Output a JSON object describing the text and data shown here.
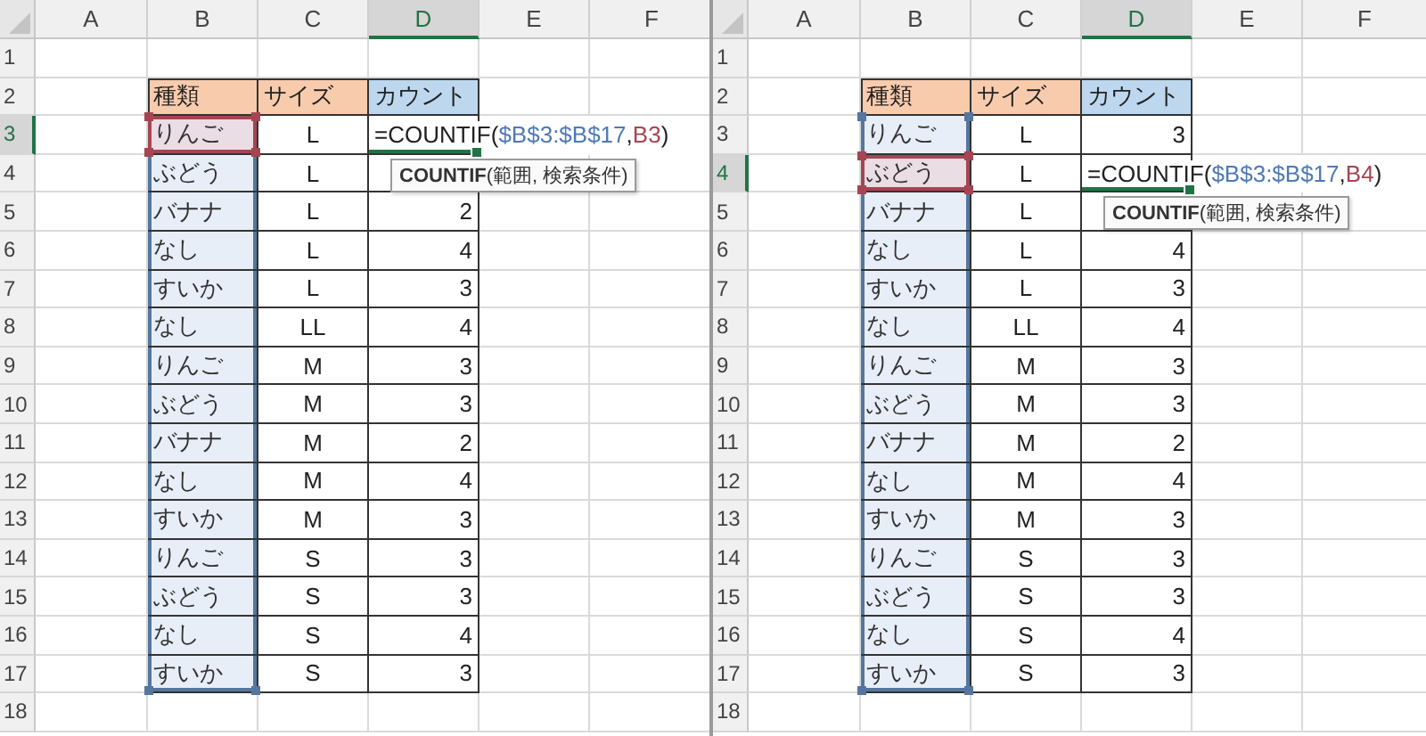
{
  "panes": [
    {
      "column_headers": [
        {
          "label": "A",
          "selected": false
        },
        {
          "label": "B",
          "selected": false
        },
        {
          "label": "C",
          "selected": false
        },
        {
          "label": "D",
          "selected": true
        },
        {
          "label": "E",
          "selected": false
        },
        {
          "label": "F",
          "selected": false
        }
      ],
      "row_headers": [
        {
          "label": "1",
          "selected": false
        },
        {
          "label": "2",
          "selected": false
        },
        {
          "label": "3",
          "selected": true
        },
        {
          "label": "4",
          "selected": false
        },
        {
          "label": "5",
          "selected": false
        },
        {
          "label": "6",
          "selected": false
        },
        {
          "label": "7",
          "selected": false
        },
        {
          "label": "8",
          "selected": false
        },
        {
          "label": "9",
          "selected": false
        },
        {
          "label": "10",
          "selected": false
        },
        {
          "label": "11",
          "selected": false
        },
        {
          "label": "12",
          "selected": false
        },
        {
          "label": "13",
          "selected": false
        },
        {
          "label": "14",
          "selected": false
        },
        {
          "label": "15",
          "selected": false
        },
        {
          "label": "16",
          "selected": false
        },
        {
          "label": "17",
          "selected": false
        },
        {
          "label": "18",
          "selected": false
        }
      ],
      "table": {
        "header": [
          {
            "label": "種類",
            "color": "#f8cbad"
          },
          {
            "label": "サイズ",
            "color": "#f8cbad"
          },
          {
            "label": "カウント",
            "color": "#bdd7ee"
          }
        ],
        "rows": [
          {
            "kind": "formula",
            "fruit": "りんご",
            "size": "L",
            "ref": true
          },
          {
            "kind": "value",
            "fruit": "ぶどう",
            "size": "L",
            "ref": false
          },
          {
            "kind": "value",
            "fruit": "バナナ",
            "size": "L",
            "count": "2",
            "ref": false
          },
          {
            "kind": "value",
            "fruit": "なし",
            "size": "L",
            "count": "4",
            "ref": false
          },
          {
            "kind": "value",
            "fruit": "すいか",
            "size": "L",
            "count": "3",
            "ref": false
          },
          {
            "kind": "value",
            "fruit": "なし",
            "size": "LL",
            "count": "4",
            "ref": false
          },
          {
            "kind": "value",
            "fruit": "りんご",
            "size": "M",
            "count": "3",
            "ref": false
          },
          {
            "kind": "value",
            "fruit": "ぶどう",
            "size": "M",
            "count": "3",
            "ref": false
          },
          {
            "kind": "value",
            "fruit": "バナナ",
            "size": "M",
            "count": "2",
            "ref": false
          },
          {
            "kind": "value",
            "fruit": "なし",
            "size": "M",
            "count": "4",
            "ref": false
          },
          {
            "kind": "value",
            "fruit": "すいか",
            "size": "M",
            "count": "3",
            "ref": false
          },
          {
            "kind": "value",
            "fruit": "りんご",
            "size": "S",
            "count": "3",
            "ref": false
          },
          {
            "kind": "value",
            "fruit": "ぶどう",
            "size": "S",
            "count": "3",
            "ref": false
          },
          {
            "kind": "value",
            "fruit": "なし",
            "size": "S",
            "count": "4",
            "ref": false
          },
          {
            "kind": "value",
            "fruit": "すいか",
            "size": "S",
            "count": "3",
            "ref": false
          }
        ]
      },
      "formula": {
        "start": "=COUNTIF(",
        "range": "$B$3:$B$17",
        "comma": ",",
        "ref": "B3",
        "end": ")"
      },
      "tooltip": "**COUNTIF**(範囲, 検索条件)"
    },
    {
      "column_headers": [
        {
          "label": "A",
          "selected": false
        },
        {
          "label": "B",
          "selected": false
        },
        {
          "label": "C",
          "selected": false
        },
        {
          "label": "D",
          "selected": true
        },
        {
          "label": "E",
          "selected": false
        },
        {
          "label": "F",
          "selected": false
        }
      ],
      "row_headers": [
        {
          "label": "1",
          "selected": false
        },
        {
          "label": "2",
          "selected": false
        },
        {
          "label": "3",
          "selected": false
        },
        {
          "label": "4",
          "selected": true
        },
        {
          "label": "5",
          "selected": false
        },
        {
          "label": "6",
          "selected": false
        },
        {
          "label": "7",
          "selected": false
        },
        {
          "label": "8",
          "selected": false
        },
        {
          "label": "9",
          "selected": false
        },
        {
          "label": "10",
          "selected": false
        },
        {
          "label": "11",
          "selected": false
        },
        {
          "label": "12",
          "selected": false
        },
        {
          "label": "13",
          "selected": false
        },
        {
          "label": "14",
          "selected": false
        },
        {
          "label": "15",
          "selected": false
        },
        {
          "label": "16",
          "selected": false
        },
        {
          "label": "17",
          "selected": false
        },
        {
          "label": "18",
          "selected": false
        }
      ],
      "table": {
        "header": [
          {
            "label": "種類",
            "color": "#f8cbad"
          },
          {
            "label": "サイズ",
            "color": "#f8cbad"
          },
          {
            "label": "カウント",
            "color": "#bdd7ee"
          }
        ],
        "rows": [
          {
            "kind": "value",
            "fruit": "りんご",
            "size": "L",
            "count": "3",
            "ref": false
          },
          {
            "kind": "formula",
            "fruit": "ぶどう",
            "size": "L",
            "ref": true
          },
          {
            "kind": "value",
            "fruit": "バナナ",
            "size": "L",
            "ref": false
          },
          {
            "kind": "value",
            "fruit": "なし",
            "size": "L",
            "count": "4",
            "ref": false
          },
          {
            "kind": "value",
            "fruit": "すいか",
            "size": "L",
            "count": "3",
            "ref": false
          },
          {
            "kind": "value",
            "fruit": "なし",
            "size": "LL",
            "count": "4",
            "ref": false
          },
          {
            "kind": "value",
            "fruit": "りんご",
            "size": "M",
            "count": "3",
            "ref": false
          },
          {
            "kind": "value",
            "fruit": "ぶどう",
            "size": "M",
            "count": "3",
            "ref": false
          },
          {
            "kind": "value",
            "fruit": "バナナ",
            "size": "M",
            "count": "2",
            "ref": false
          },
          {
            "kind": "value",
            "fruit": "なし",
            "size": "M",
            "count": "4",
            "ref": false
          },
          {
            "kind": "value",
            "fruit": "すいか",
            "size": "M",
            "count": "3",
            "ref": false
          },
          {
            "kind": "value",
            "fruit": "りんご",
            "size": "S",
            "count": "3",
            "ref": false
          },
          {
            "kind": "value",
            "fruit": "ぶどう",
            "size": "S",
            "count": "3",
            "ref": false
          },
          {
            "kind": "value",
            "fruit": "なし",
            "size": "S",
            "count": "4",
            "ref": false
          },
          {
            "kind": "value",
            "fruit": "すいか",
            "size": "S",
            "count": "3",
            "ref": false
          }
        ]
      },
      "formula": {
        "start": "=COUNTIF(",
        "range": "$B$3:$B$17",
        "comma": ",",
        "ref": "B4",
        "end": ")"
      },
      "tooltip": "**COUNTIF**(範囲, 検索条件)"
    }
  ]
}
